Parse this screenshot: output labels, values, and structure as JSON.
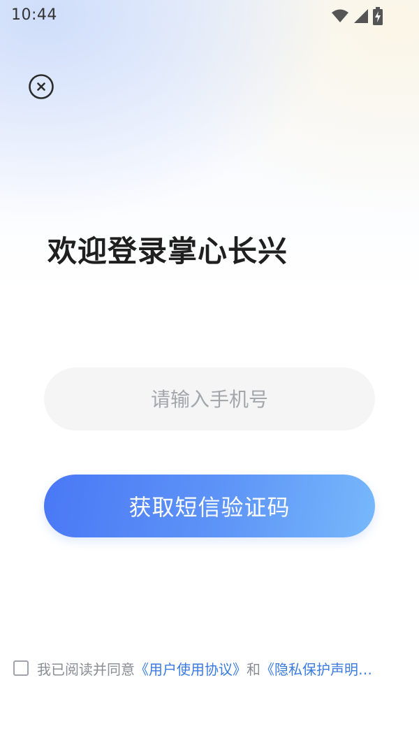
{
  "status_bar": {
    "time": "10:44",
    "icons": [
      "wifi-icon",
      "cellular-signal-icon",
      "battery-charging-icon"
    ]
  },
  "close_button": {
    "icon": "close-circle-icon"
  },
  "title": "欢迎登录掌心长兴",
  "phone_input": {
    "placeholder": "请输入手机号",
    "value": ""
  },
  "sms_button": {
    "label": "获取短信验证码"
  },
  "agreement": {
    "checked": false,
    "prefix": "我已阅读并同意",
    "user_agreement_link": "《用户使用协议》",
    "conjunction": "和",
    "privacy_link": "《隐私保护声明…"
  },
  "colors": {
    "accent": "#4a78f6",
    "link": "#3a7be0",
    "title": "#1f1f1f",
    "input_bg": "#f5f5f6"
  }
}
